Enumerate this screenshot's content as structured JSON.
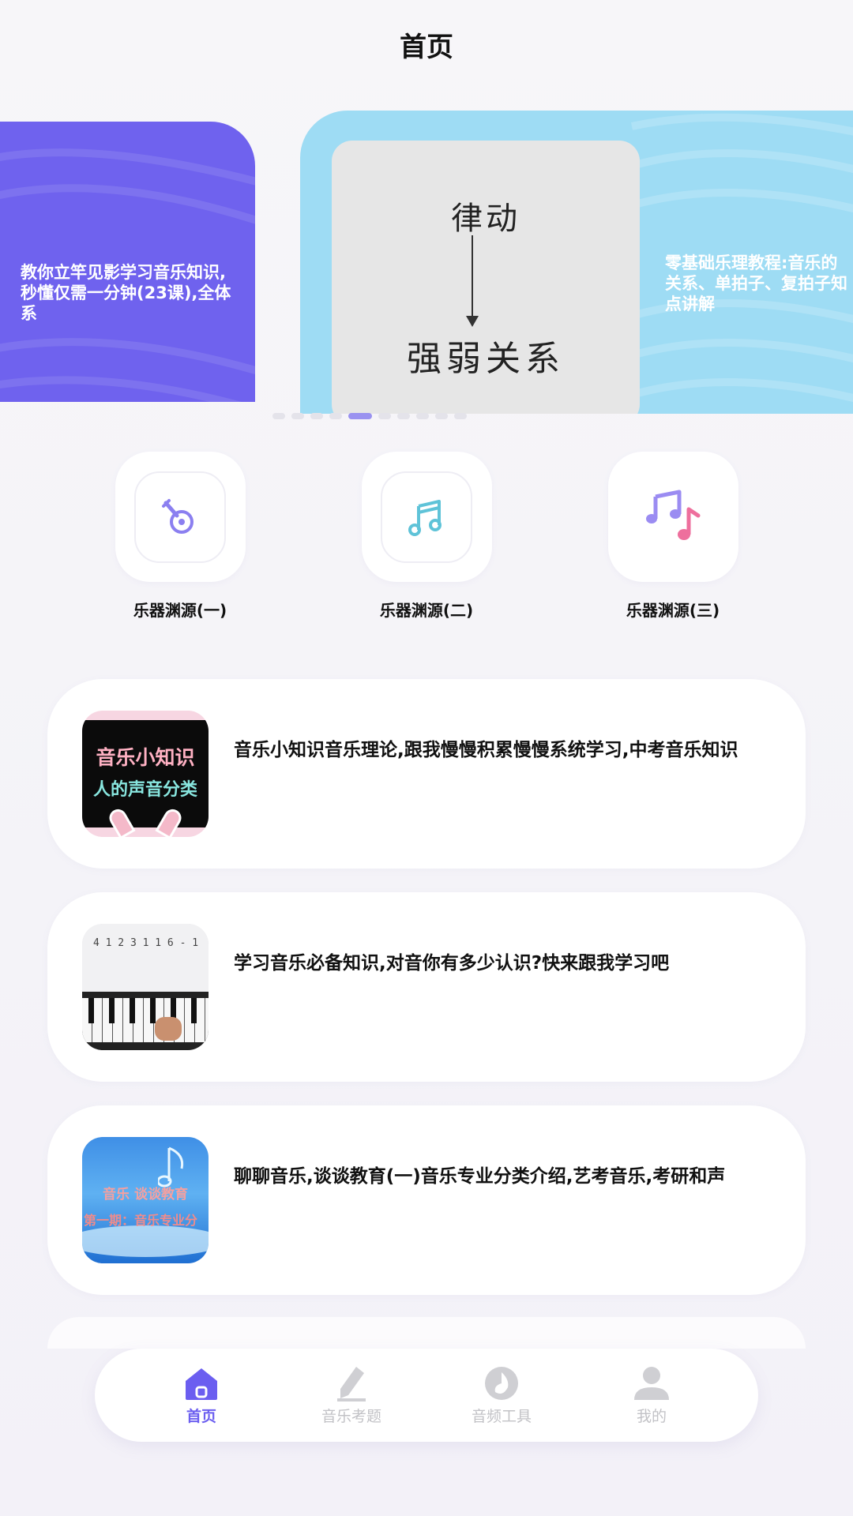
{
  "header": {
    "title": "首页"
  },
  "carousel": {
    "left_caption": "教你立竿见影学习音乐知识,秒懂仅需一分钟(23课),全体系",
    "thumb_top": "律动",
    "thumb_bottom": "强弱关系",
    "right_caption_lines": [
      "零基础乐理教程:音乐的",
      "关系、单拍子、复拍子知",
      "点讲解"
    ],
    "dot_count": 10,
    "active_dot": 4
  },
  "categories": [
    {
      "label": "乐器渊源(一)",
      "icon": "guitar-icon"
    },
    {
      "label": "乐器渊源(二)",
      "icon": "music-note-icon"
    },
    {
      "label": "乐器渊源(三)",
      "icon": "music-notes-icon"
    }
  ],
  "list": [
    {
      "title": "音乐小知识音乐理论,跟我慢慢积累慢慢系统学习,中考音乐知识",
      "cover_line1": "音乐小知识",
      "cover_line2": "人的声音分类"
    },
    {
      "title": "学习音乐必备知识,对音你有多少认识?快来跟我学习吧",
      "cover_scribble": "4 1 2 3 1 1 6 - 1"
    },
    {
      "title": "聊聊音乐,谈谈教育(一)音乐专业分类介绍,艺考音乐,考研和声",
      "cover_line1": "音乐  谈谈教育",
      "cover_line2": "第一期：音乐专业分"
    }
  ],
  "tabbar": [
    {
      "label": "首页",
      "icon": "home-icon",
      "active": true
    },
    {
      "label": "音乐考题",
      "icon": "pencil-icon",
      "active": false
    },
    {
      "label": "音频工具",
      "icon": "disc-icon",
      "active": false
    },
    {
      "label": "我的",
      "icon": "user-icon",
      "active": false
    }
  ],
  "colors": {
    "accent": "#6b5ef0",
    "card_purple": "#6f62ee",
    "card_blue": "#9edcf4",
    "inactive": "#c2c2c6"
  }
}
